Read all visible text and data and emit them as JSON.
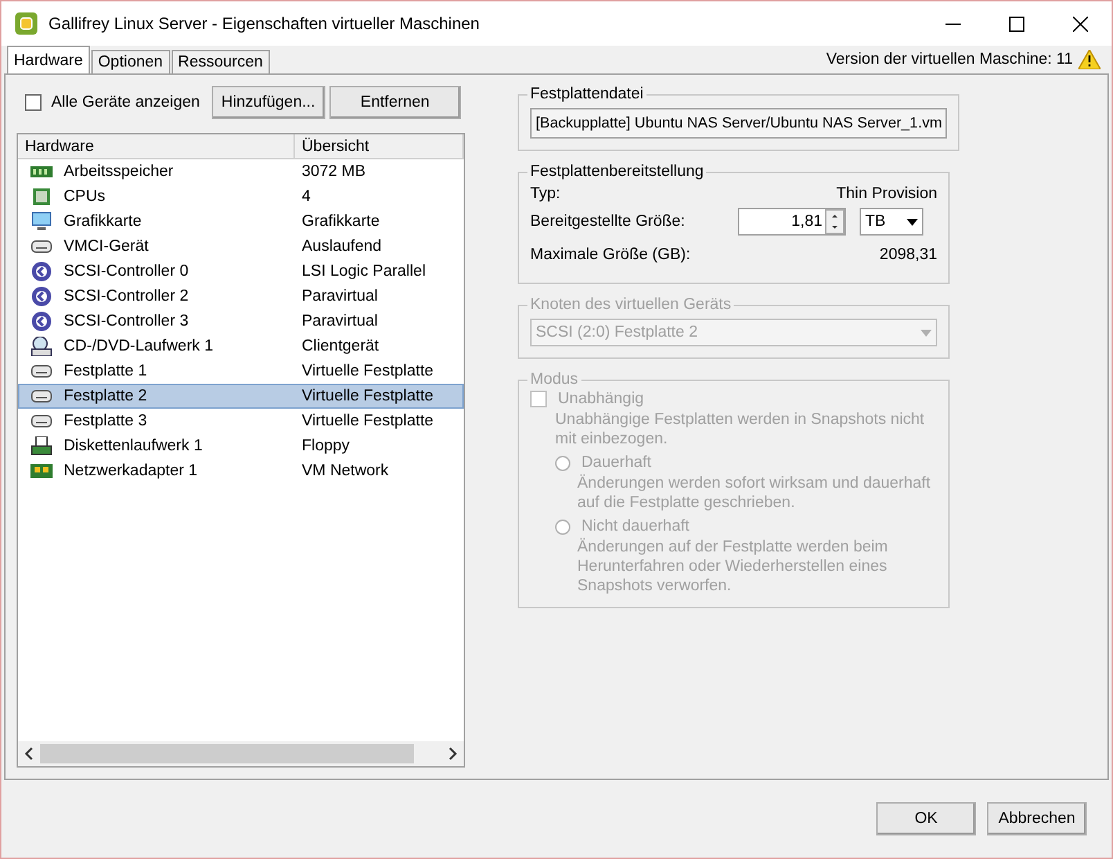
{
  "window": {
    "title": "Gallifrey Linux Server - Eigenschaften virtueller Maschinen"
  },
  "tabs": [
    {
      "label": "Hardware",
      "selected": true
    },
    {
      "label": "Optionen",
      "selected": false
    },
    {
      "label": "Ressourcen",
      "selected": false
    }
  ],
  "vm_version": "Version der virtuellen Maschine: 11",
  "show_all_devices": {
    "label": "Alle Geräte anzeigen",
    "checked": false
  },
  "toolbar_buttons": [
    "Hinzufügen...",
    "Entfernen"
  ],
  "table": {
    "columns": [
      "Hardware",
      "Übersicht"
    ],
    "rows": [
      {
        "kind": "memory",
        "name": "Arbeitsspeicher",
        "summary": "3072 MB",
        "selected": false
      },
      {
        "kind": "cpu",
        "name": "CPUs",
        "summary": "4",
        "selected": false
      },
      {
        "kind": "display",
        "name": "Grafikkarte",
        "summary": "Grafikkarte",
        "selected": false
      },
      {
        "kind": "device",
        "name": "VMCI-Gerät",
        "summary": "Auslaufend",
        "selected": false
      },
      {
        "kind": "scsi",
        "name": "SCSI-Controller 0",
        "summary": "LSI Logic Parallel",
        "selected": false
      },
      {
        "kind": "scsi",
        "name": "SCSI-Controller 2",
        "summary": "Paravirtual",
        "selected": false
      },
      {
        "kind": "scsi",
        "name": "SCSI-Controller 3",
        "summary": "Paravirtual",
        "selected": false
      },
      {
        "kind": "cd",
        "name": "CD-/DVD-Laufwerk 1",
        "summary": "Clientgerät",
        "selected": false
      },
      {
        "kind": "disk",
        "name": "Festplatte 1",
        "summary": "Virtuelle Festplatte",
        "selected": false
      },
      {
        "kind": "disk",
        "name": "Festplatte 2",
        "summary": "Virtuelle Festplatte",
        "selected": true
      },
      {
        "kind": "disk",
        "name": "Festplatte 3",
        "summary": "Virtuelle Festplatte",
        "selected": false
      },
      {
        "kind": "floppy",
        "name": "Diskettenlaufwerk 1",
        "summary": "Floppy",
        "selected": false
      },
      {
        "kind": "network",
        "name": "Netzwerkadapter 1",
        "summary": "VM Network",
        "selected": false
      }
    ]
  },
  "disk_file": {
    "title": "Festplattendatei",
    "value": "[Backupplatte] Ubuntu NAS Server/Ubuntu NAS Server_1.vm"
  },
  "provisioning": {
    "title": "Festplattenbereitstellung",
    "type_label": "Typ:",
    "type_value": "Thin Provision",
    "size_label": "Bereitgestellte Größe:",
    "size_value": "1,81",
    "unit": "TB",
    "max_label": "Maximale Größe (GB):",
    "max_value": "2098,31"
  },
  "device_node": {
    "title": "Knoten des virtuellen Geräts",
    "value": "SCSI (2:0) Festplatte 2",
    "disabled": true
  },
  "mode": {
    "title": "Modus",
    "disabled": true,
    "independent": {
      "label": "Unabhängig",
      "checked": false,
      "description": "Unabhängige Festplatten werden in Snapshots nicht mit einbezogen."
    },
    "options": [
      {
        "label": "Dauerhaft",
        "description": "Änderungen werden sofort wirksam und dauerhaft auf die Festplatte geschrieben.",
        "selected": false
      },
      {
        "label": "Nicht dauerhaft",
        "description": "Änderungen auf der Festplatte werden beim Herunterfahren oder Wiederherstellen eines Snapshots verworfen.",
        "selected": false
      }
    ]
  },
  "footer_buttons": [
    "OK",
    "Abbrechen"
  ]
}
